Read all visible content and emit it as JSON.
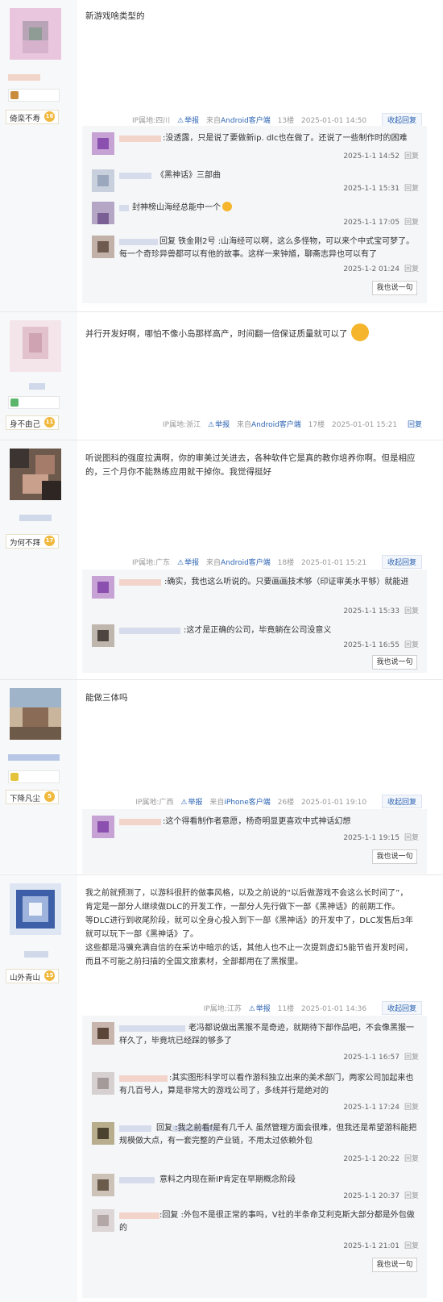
{
  "posts": [
    {
      "user": "倚栾不寿",
      "level": "16",
      "text": "新游戏啥类型的",
      "meta": {
        "ip": "IP属地:四川",
        "report": "举报",
        "source_prefix": "来自",
        "source": "Android客户端",
        "floor": "13楼",
        "time": "2025-01-01 14:50",
        "toggle": "收起回复"
      },
      "replies": [
        {
          "text": ":没透露，只是说了要做新ip. dlc也在做了。还说了一些制作时的困难",
          "time": "2025-1-1 14:52",
          "action": "回复"
        },
        {
          "text": "《黑神话》三部曲",
          "time": "2025-1-1 15:31",
          "action": "回复"
        },
        {
          "text": "封神榜山海经总能中一个",
          "time": "2025-1-1 17:05",
          "action": "回复"
        },
        {
          "text": "回复 铁金刚2号 :山海经可以啊，这么多怪物，可以来个中式宝可梦了。每一个奇珍异兽都可以有他的故事。这样一来钟馗，聊斋志异也可以有了",
          "time": "2025-1-2 01:24",
          "action": "回复"
        }
      ],
      "say": "我也说一句"
    },
    {
      "user": "身不由己",
      "level": "11",
      "text": "并行开发好啊，哪怕不像小岛那样高产，时间翻一倍保证质量就可以了",
      "meta": {
        "ip": "IP属地:浙江",
        "report": "举报",
        "source_prefix": "来自",
        "source": "Android客户端",
        "floor": "17楼",
        "time": "2025-01-01 15:21",
        "toggle": "回复"
      }
    },
    {
      "user": "为何不拜",
      "level": "17",
      "text": "听说图科的强度拉满啊，你的审美过关进去，各种软件它是真的教你培养你啊。但是相应的，三个月你不能熟练应用就干掉你。我觉得挺好",
      "meta": {
        "ip": "IP属地:广东",
        "report": "举报",
        "source_prefix": "来自",
        "source": "Android客户端",
        "floor": "18楼",
        "time": "2025-01-01 15:21",
        "toggle": "收起回复"
      },
      "replies": [
        {
          "text": ":确实，我也这么听说的。只要画画技术够（印证审美水平够）就能进",
          "time": "2025-1-1 15:33",
          "action": "回复"
        },
        {
          "text": ":这才是正确的公司，毕竟躺在公司没意义",
          "time": "2025-1-1 16:55",
          "action": "回复"
        }
      ],
      "say": "我也说一句"
    },
    {
      "user": "下降凡尘",
      "level": "5",
      "text": "能做三体吗",
      "meta": {
        "ip": "IP属地:广西",
        "report": "举报",
        "source_prefix": "来自",
        "source": "iPhone客户端",
        "floor": "26楼",
        "time": "2025-01-01 19:10",
        "toggle": "收起回复"
      },
      "replies": [
        {
          "text": ":这个得看制作者意愿，杨奇明显更喜欢中式神话幻想",
          "time": "2025-1-1 19:15",
          "action": "回复"
        }
      ],
      "say": "我也说一句"
    },
    {
      "user": "山外青山",
      "level": "15",
      "text_lines": [
        "我之前就预测了，以游科很肝的做事风格，以及之前说的“以后做游戏不会这么长时间了”，",
        "肯定是一部分人继续做DLC的开发工作，一部分人先行做下一部《黑神话》的前期工作。",
        "等DLC进行到收尾阶段，就可以全身心投入到下一部《黑神话》的开发中了，DLC发售后3年",
        "就可以玩下一部《黑神话》了。",
        "这些都是冯骥充满自信的在采访中暗示的话，其他人也不止一次提到虚幻5能节省开发时间，",
        "而且不可能之前扫描的全国文旅素材，全部都用在了黑猴里。"
      ],
      "meta": {
        "ip": "IP属地:江苏",
        "report": "举报",
        "floor": "11楼",
        "time": "2025-01-01 14:36",
        "toggle": "收起回复"
      },
      "replies": [
        {
          "text": "老冯都说做出黑猴不是奇迹，就期待下部作品吧，不会像黑猴一样久了，毕竟坑已经踩的够多了",
          "time": "2025-1-1 16:57",
          "action": "回复"
        },
        {
          "text": ":其实图形科学可以看作游科独立出来的美术部门，两家公司加起来也有几百号人，算是非常大的游戏公司了，多线并行是绝对的",
          "time": "2025-1-1 17:24",
          "action": "回复"
        },
        {
          "text": "回复 :我之前看f是有几千人 虽然管理方面会很难，但我还是希望游科能把规模做大点，有一套完整的产业链，不用太过依赖外包",
          "time": "2025-1-1 20:22",
          "action": "回复"
        },
        {
          "text": "意料之内现在新IP肯定在早期概念阶段",
          "time": "2025-1-1 20:37",
          "action": "回复"
        },
        {
          "text": ":回复 :外包不是很正常的事吗，V社的半条命艾利克斯大部分都是外包做的",
          "time": "2025-1-1 21:01",
          "action": "回复"
        }
      ],
      "say": "我也说一句"
    }
  ]
}
